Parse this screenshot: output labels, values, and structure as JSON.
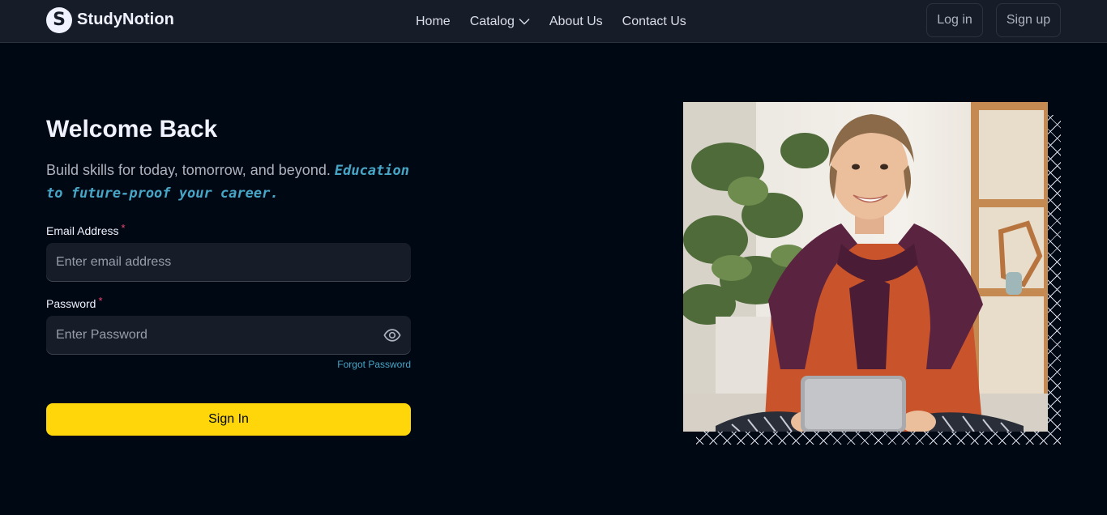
{
  "brand": {
    "name": "StudyNotion",
    "logo_letter": "S"
  },
  "nav": {
    "links": [
      {
        "label": "Home"
      },
      {
        "label": "Catalog",
        "has_dropdown": true
      },
      {
        "label": "About Us"
      },
      {
        "label": "Contact Us"
      }
    ],
    "login_label": "Log in",
    "signup_label": "Sign up"
  },
  "form": {
    "title": "Welcome Back",
    "subtitle": "Build skills for today, tomorrow, and beyond.",
    "subtitle_accent": "Education to future-proof your career.",
    "email": {
      "label": "Email Address",
      "required_mark": "*",
      "placeholder": "Enter email address",
      "value": ""
    },
    "password": {
      "label": "Password",
      "required_mark": "*",
      "placeholder": "Enter Password",
      "value": "",
      "toggle_icon": "eye-icon"
    },
    "forgot_label": "Forgot Password",
    "submit_label": "Sign In"
  },
  "colors": {
    "page_bg": "#000814",
    "nav_bg": "#161D29",
    "accent_yellow": "#FFD60A",
    "accent_blue": "#47A5C5",
    "required_red": "#EF476F"
  }
}
